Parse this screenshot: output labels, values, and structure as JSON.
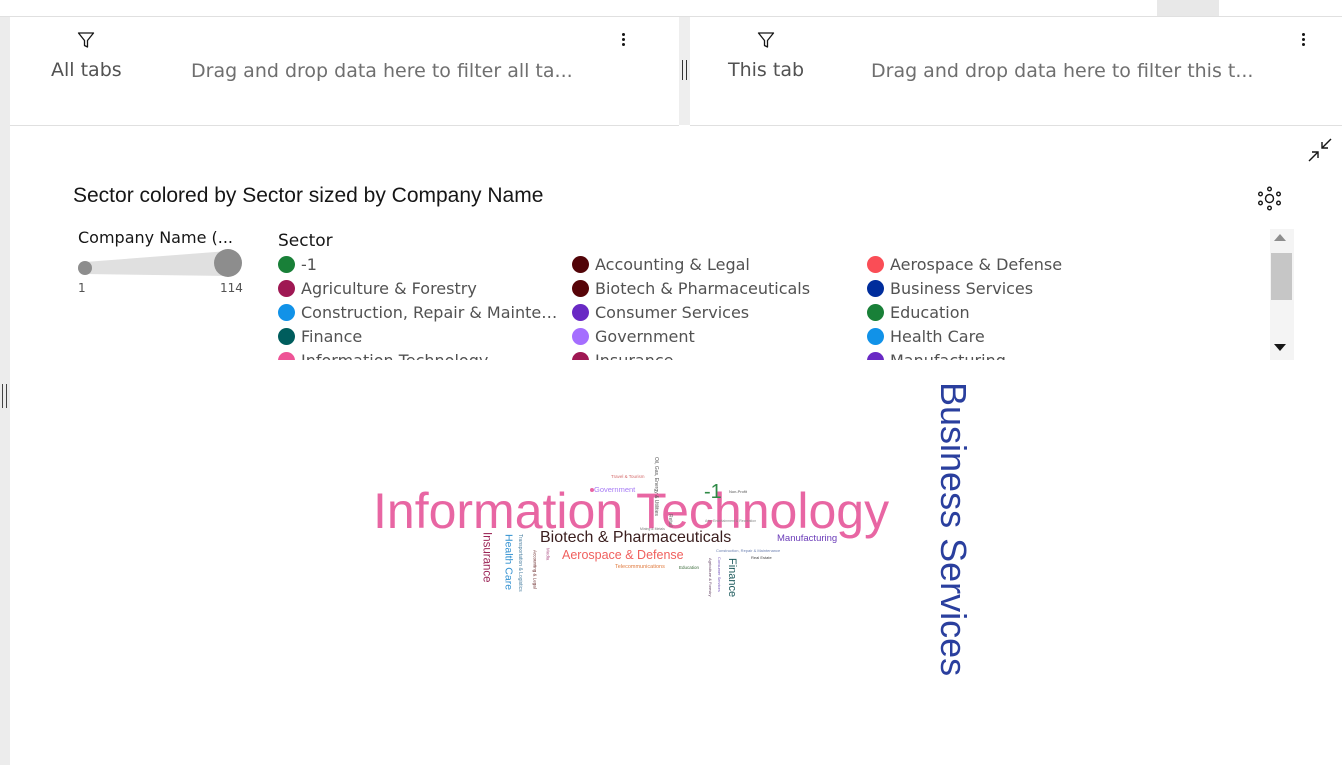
{
  "filters": {
    "all": {
      "label": "All tabs",
      "placeholder": "Drag and drop data here to filter all ta..."
    },
    "tab": {
      "label": "This tab",
      "placeholder": "Drag and drop data here to filter this t..."
    }
  },
  "chart": {
    "title": "Sector colored by Sector sized by Company Name",
    "size_legend": {
      "title": "Company Name (...",
      "min": "1",
      "max": "114"
    },
    "color_legend": {
      "title": "Sector",
      "items": [
        {
          "label": "-1",
          "color": "#198038"
        },
        {
          "label": "Accounting & Legal",
          "color": "#520408"
        },
        {
          "label": "Aerospace & Defense",
          "color": "#fa4d56"
        },
        {
          "label": "Agriculture & Forestry",
          "color": "#9f1853"
        },
        {
          "label": "Biotech & Pharmaceuticals",
          "color": "#570408"
        },
        {
          "label": "Business Services",
          "color": "#002d9c"
        },
        {
          "label": "Construction, Repair & Maintenan...",
          "color": "#1192e8"
        },
        {
          "label": "Consumer Services",
          "color": "#6929c4"
        },
        {
          "label": "Education",
          "color": "#198038"
        },
        {
          "label": "Finance",
          "color": "#005d5d"
        },
        {
          "label": "Government",
          "color": "#a56eff"
        },
        {
          "label": "Health Care",
          "color": "#1192e8"
        },
        {
          "label": "Information Technology",
          "color": "#ee5396"
        },
        {
          "label": "Insurance",
          "color": "#9f1853"
        },
        {
          "label": "Manufacturing",
          "color": "#6929c4"
        }
      ]
    },
    "cloud": [
      {
        "text": "Information Technology",
        "color": "#e866a3"
      },
      {
        "text": "Business Services",
        "color": "#2a3f9e"
      },
      {
        "text": "Biotech & Pharmaceuticals",
        "color": "#3a1e1e"
      },
      {
        "text": "Aerospace & Defense",
        "color": "#f0605e"
      },
      {
        "text": "-1",
        "color": "#2e8a46"
      },
      {
        "text": "Insurance",
        "color": "#9b2456"
      },
      {
        "text": "Health Care",
        "color": "#2f8fd0"
      },
      {
        "text": "Finance",
        "color": "#1f5c5e"
      },
      {
        "text": "Manufacturing",
        "color": "#6a3bb8"
      },
      {
        "text": "Government",
        "color": "#a77cf5"
      },
      {
        "text": "Telecommunications",
        "color": "#e07b3f"
      },
      {
        "text": "Travel & Tourism",
        "color": "#d46a6a"
      },
      {
        "text": "Oil, Gas, Energy & Utilities",
        "color": "#555555"
      },
      {
        "text": "Retail",
        "color": "#666666"
      },
      {
        "text": "Non-Profit",
        "color": "#555555"
      },
      {
        "text": "Transportation & Logistics",
        "color": "#4a7fa0"
      },
      {
        "text": "Accounting & Legal",
        "color": "#6a2a2a"
      },
      {
        "text": "Media",
        "color": "#b25a8c"
      },
      {
        "text": "Construction, Repair & Maintenance",
        "color": "#6a7fb0"
      },
      {
        "text": "Consumer Services",
        "color": "#7a5abf"
      },
      {
        "text": "Real Estate",
        "color": "#444444"
      },
      {
        "text": "Education",
        "color": "#3a6a3a"
      },
      {
        "text": "Agriculture & Forestry",
        "color": "#6a4a6a"
      },
      {
        "text": "Arts, Entertainment & Recreation",
        "color": "#888888"
      },
      {
        "text": "Mining & Metals",
        "color": "#777777"
      }
    ]
  }
}
